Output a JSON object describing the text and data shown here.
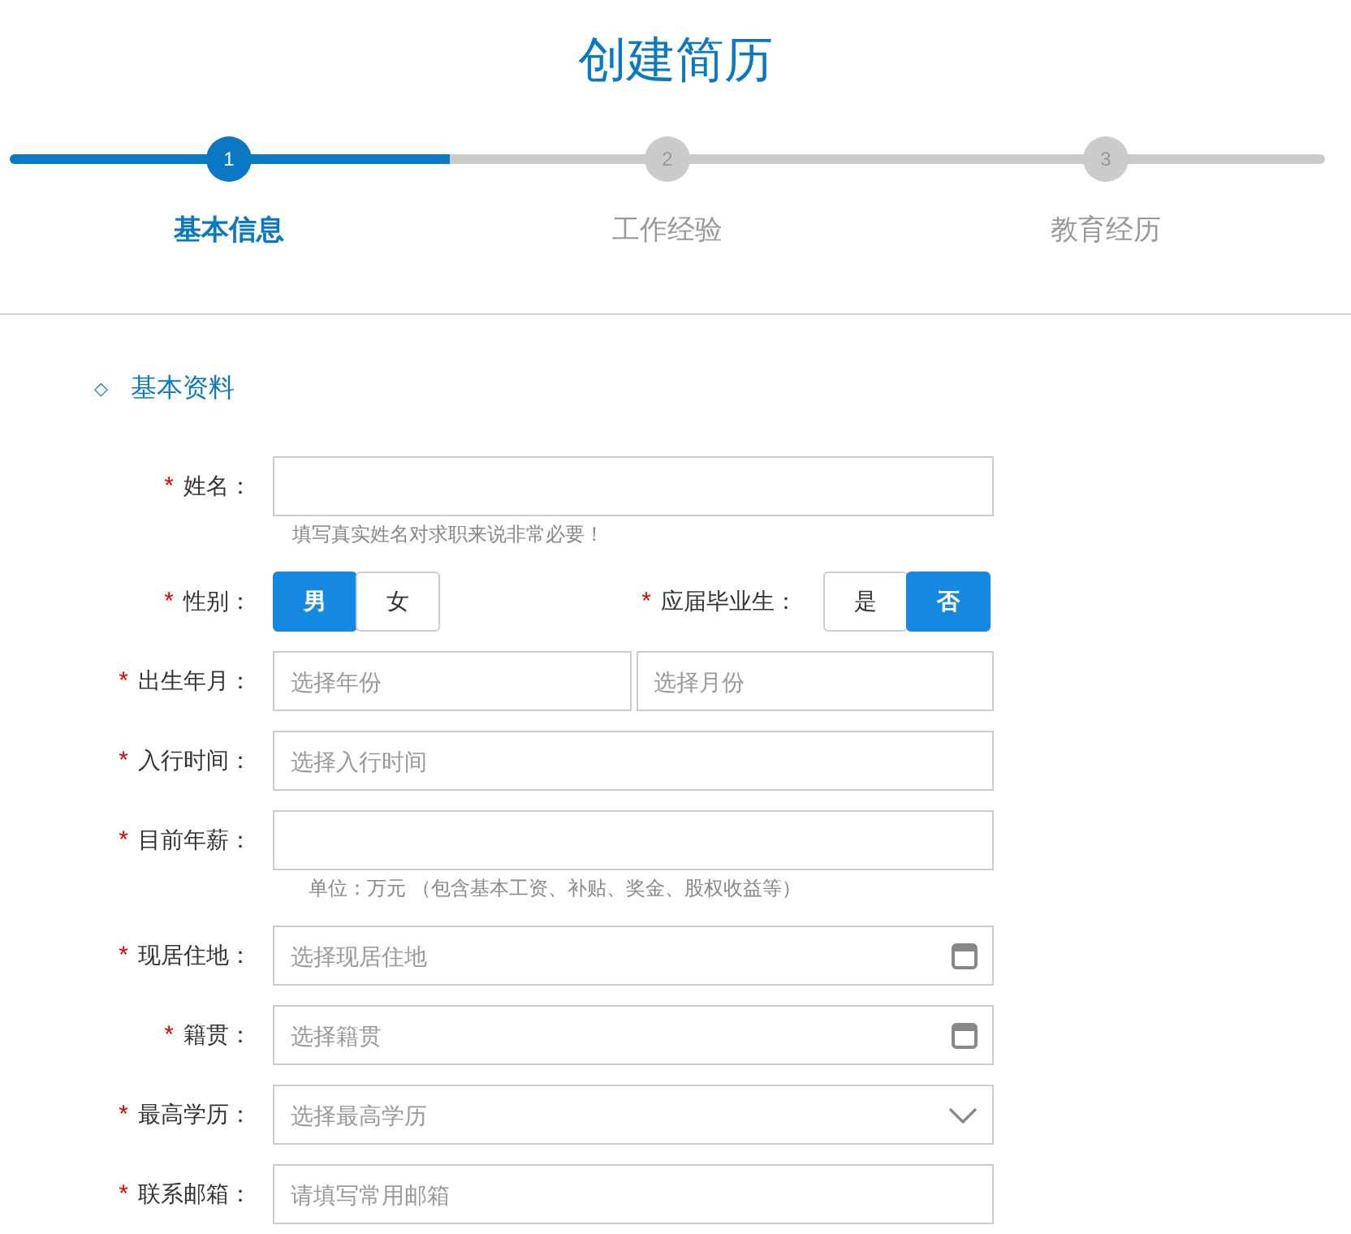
{
  "title": "创建简历",
  "steps": {
    "level": 0.334,
    "items": [
      {
        "number": "1",
        "label": "基本信息",
        "selected": true
      },
      {
        "number": "2",
        "label": "工作经验",
        "selected": false
      },
      {
        "number": "3",
        "label": "教育经历",
        "selected": false
      }
    ]
  },
  "section": {
    "marker": "◇",
    "title": "基本资料"
  },
  "fields": [
    {
      "kind": "text",
      "mark": "*",
      "label": "姓名：",
      "hint": "填写真实姓名对求职来说非常必要！"
    },
    {
      "kind": "toggles",
      "groups": [
        {
          "mark": "*",
          "label": "性别：",
          "options": [
            {
              "label": "男",
              "selected": true
            },
            {
              "label": "女",
              "selected": false
            }
          ]
        },
        {
          "mark": "*",
          "label": "应届毕业生：",
          "options": [
            {
              "label": "是",
              "selected": false
            },
            {
              "label": "否",
              "selected": true
            }
          ]
        }
      ]
    },
    {
      "kind": "pair",
      "mark": "*",
      "label": "出生年月：",
      "inputs": [
        {
          "placeholder": "选择年份"
        },
        {
          "placeholder": "选择月份"
        }
      ]
    },
    {
      "kind": "text",
      "mark": "*",
      "label": "入行时间：",
      "placeholder": "选择入行时间"
    },
    {
      "kind": "text",
      "mark": "*",
      "label": "目前年薪：",
      "hint": "单位：万元 （包含基本工资、补贴、奖金、股权收益等）"
    },
    {
      "kind": "calendar",
      "mark": "*",
      "label": "现居住地：",
      "placeholder": "选择现居住地"
    },
    {
      "kind": "calendar",
      "mark": "*",
      "label": "籍贯：",
      "placeholder": "选择籍贯"
    },
    {
      "kind": "dropdown",
      "mark": "*",
      "label": "最高学历：",
      "placeholder": "选择最高学历"
    },
    {
      "kind": "text",
      "mark": "*",
      "label": "联系邮箱：",
      "placeholder": "请填写常用邮箱"
    }
  ]
}
